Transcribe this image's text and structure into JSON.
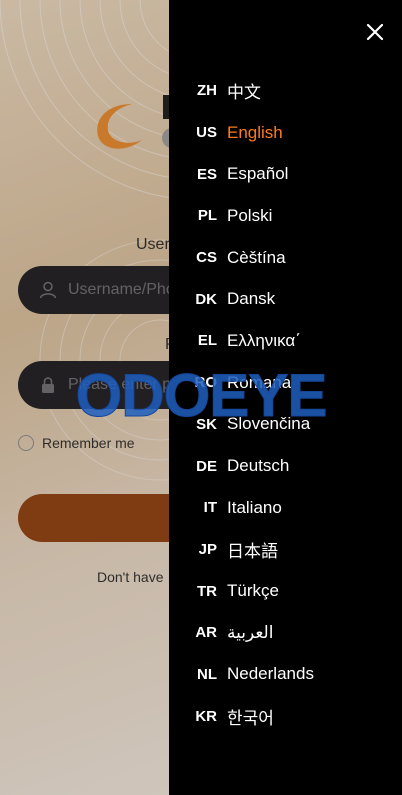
{
  "login": {
    "username_label": "Username",
    "username_placeholder": "Username/Phone",
    "password_label": "Password",
    "password_placeholder": "Please enter password",
    "remember_label": "Remember me",
    "signup_prompt": "Don't have"
  },
  "drawer": {
    "close_icon": "close-icon",
    "active_color": "#ff7a1c",
    "languages": [
      {
        "code": "ZH",
        "name": "中文"
      },
      {
        "code": "US",
        "name": "English",
        "active": true
      },
      {
        "code": "ES",
        "name": "Español"
      },
      {
        "code": "PL",
        "name": "Polski"
      },
      {
        "code": "CS",
        "name": "Cèštína"
      },
      {
        "code": "DK",
        "name": "Dansk"
      },
      {
        "code": "EL",
        "name": "Ελληνικα΄"
      },
      {
        "code": "RO",
        "name": "Romana"
      },
      {
        "code": "SK",
        "name": "Slovenčina"
      },
      {
        "code": "DE",
        "name": "Deutsch"
      },
      {
        "code": "IT",
        "name": "Italiano"
      },
      {
        "code": "JP",
        "name": "日本語"
      },
      {
        "code": "TR",
        "name": "Türkçe"
      },
      {
        "code": "AR",
        "name": "العربية"
      },
      {
        "code": "NL",
        "name": "Nederlands"
      },
      {
        "code": "KR",
        "name": "한국어"
      }
    ]
  },
  "watermark": {
    "text": "ODOEYE",
    "color": "#1f5fc0"
  }
}
